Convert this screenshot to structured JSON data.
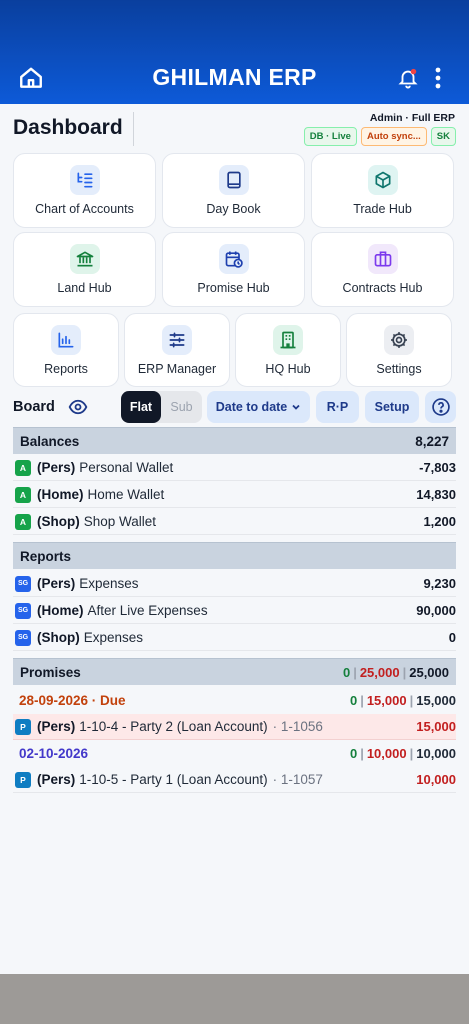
{
  "header": {
    "title": "GHILMAN ERP"
  },
  "page": {
    "title": "Dashboard",
    "user": "Admin · Full ERP",
    "chips": [
      {
        "label": "DB · Live",
        "tone": "green"
      },
      {
        "label": "Auto sync...",
        "tone": "orange"
      },
      {
        "label": "SK",
        "tone": "green"
      }
    ]
  },
  "tiles": [
    {
      "label": "Chart of Accounts",
      "icon": "list-tree-icon"
    },
    {
      "label": "Day Book",
      "icon": "book-icon"
    },
    {
      "label": "Trade Hub",
      "icon": "box-icon"
    },
    {
      "label": "Land Hub",
      "icon": "bank-icon"
    },
    {
      "label": "Promise Hub",
      "icon": "calendar-clock-icon"
    },
    {
      "label": "Contracts Hub",
      "icon": "briefcase-icon"
    },
    {
      "label": "Reports",
      "icon": "bar-chart-icon"
    },
    {
      "label": "ERP Manager",
      "icon": "sliders-icon"
    },
    {
      "label": "HQ Hub",
      "icon": "building-icon"
    },
    {
      "label": "Settings",
      "icon": "gear-icon"
    }
  ],
  "board": {
    "label": "Board",
    "toggle": {
      "flat": "Flat",
      "sub": "Sub"
    },
    "date_filter": "Date to date",
    "rp": "R·P",
    "setup": "Setup"
  },
  "balances": {
    "title": "Balances",
    "total": "8,227",
    "rows": [
      {
        "badge": "A",
        "tag": "(Pers)",
        "name": "Personal Wallet",
        "amount": "-7,803"
      },
      {
        "badge": "A",
        "tag": "(Home)",
        "name": "Home Wallet",
        "amount": "14,830"
      },
      {
        "badge": "A",
        "tag": "(Shop)",
        "name": "Shop Wallet",
        "amount": "1,200"
      }
    ]
  },
  "reports": {
    "title": "Reports",
    "rows": [
      {
        "badge": "SG",
        "tag": "(Pers)",
        "name": "Expenses",
        "amount": "9,230"
      },
      {
        "badge": "SG",
        "tag": "(Home)",
        "name": "After Live Expenses",
        "amount": "90,000"
      },
      {
        "badge": "SG",
        "tag": "(Shop)",
        "name": "Expenses",
        "amount": "0"
      }
    ]
  },
  "promises": {
    "title": "Promises",
    "totals": {
      "paid": "0",
      "due": "25,000",
      "total": "25,000"
    },
    "groups": [
      {
        "date": "28-09-2026 · Due",
        "paid": "0",
        "due": "15,000",
        "total": "15,000",
        "item": {
          "badge": "P",
          "tag": "(Pers)",
          "name": "1-10-4 - Party 2 (Loan Account)",
          "ref": "· 1-1056",
          "amount": "15,000"
        }
      },
      {
        "date": "02-10-2026",
        "paid": "0",
        "due": "10,000",
        "total": "10,000",
        "item": {
          "badge": "P",
          "tag": "(Pers)",
          "name": "1-10-5 - Party 1 (Loan Account)",
          "ref": "· 1-1057",
          "amount": "10,000"
        }
      }
    ]
  },
  "colors": {
    "header": "#0d5ad8",
    "section": "#c9d3df",
    "accent_red": "#c21f1f",
    "accent_green": "#15803d",
    "due_date": "#c2410c",
    "date": "#4338ca"
  }
}
